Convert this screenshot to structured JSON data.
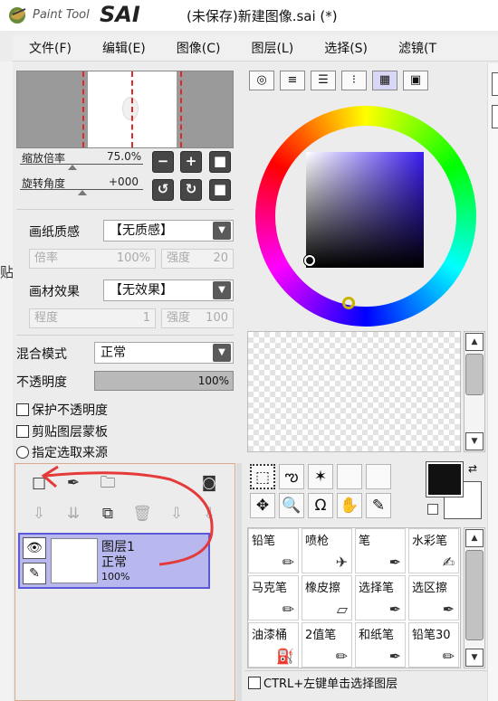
{
  "app": {
    "logo_small": "Paint Tool",
    "logo_big": "SAI",
    "title": "(未保存)新建图像.sai (*)"
  },
  "menu": [
    "文件(F)",
    "编辑(E)",
    "图像(C)",
    "图层(L)",
    "选择(S)",
    "滤镜(T"
  ],
  "left_glyph": "贴",
  "navigator": {
    "zoom_label": "缩放倍率",
    "zoom_value": "75.0%",
    "rotate_label": "旋转角度",
    "rotate_value": "+000",
    "buttons": {
      "minus": "−",
      "plus": "+",
      "fit": "■",
      "rot_left": "↺",
      "rot_right": "↻",
      "reset": "■"
    }
  },
  "texture": {
    "paper_label": "画纸质感",
    "paper_value": "【无质感】",
    "rate_label": "倍率",
    "rate_value": "100%",
    "strength_label": "强度",
    "strength_value": "20",
    "effect_label": "画材效果",
    "effect_value": "【无效果】",
    "degree_label": "程度",
    "degree_value": "1",
    "strength2_label": "强度",
    "strength2_value": "100"
  },
  "layer_opts": {
    "blend_label": "混合模式",
    "blend_value": "正常",
    "opacity_label": "不透明度",
    "opacity_value": "100%",
    "protect": "保护不透明度",
    "clip": "剪贴图层蒙板",
    "source": "指定选取来源"
  },
  "layer_toolbar": {
    "new_layer": "□",
    "new_pen": "✒",
    "new_folder": "🗀",
    "mask": "◙",
    "apply": "⇩",
    "clear": "⇊",
    "fill": "⧉",
    "delete": "🗑",
    "merge": "⇩",
    "merge2": "⇩"
  },
  "layer": {
    "name": "图层1",
    "mode": "正常",
    "opacity": "100%",
    "eye": "👁",
    "pen": "✎"
  },
  "color_tabs": [
    "◎",
    "≡",
    "☰",
    "⁝",
    "▦",
    "▣"
  ],
  "selection_tools": [
    "⬚",
    "ఌ",
    "✶",
    "",
    ""
  ],
  "view_tools": [
    "✥",
    "🔍",
    "Ω",
    "✋",
    "✎"
  ],
  "colors": {
    "primary": "#111111",
    "secondary": "#ffffff",
    "square_hue": "#3a1cf0"
  },
  "tools": [
    {
      "label": "铅笔",
      "icon": "✏"
    },
    {
      "label": "喷枪",
      "icon": "✈"
    },
    {
      "label": "笔",
      "icon": "✒"
    },
    {
      "label": "水彩笔",
      "icon": "✍"
    },
    {
      "label": "马克笔",
      "icon": "✏"
    },
    {
      "label": "橡皮擦",
      "icon": "▱"
    },
    {
      "label": "选择笔",
      "icon": "✒"
    },
    {
      "label": "选区擦",
      "icon": "✒"
    },
    {
      "label": "油漆桶",
      "icon": "⛽"
    },
    {
      "label": "2值笔",
      "icon": "✏"
    },
    {
      "label": "和纸笔",
      "icon": "✒"
    },
    {
      "label": "铅笔30",
      "icon": "✏"
    }
  ],
  "bottom_check": "CTRL+左键单击选择图层",
  "annotation_color": "#e53a3a"
}
